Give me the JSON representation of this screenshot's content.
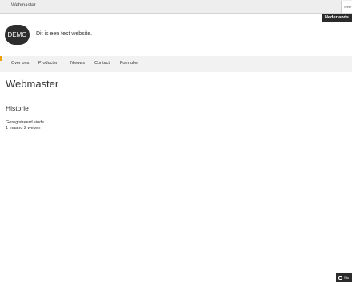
{
  "topbar": {
    "site_title": "Webmaster",
    "tab_label": "Webr"
  },
  "language": {
    "selected": "Nederlands"
  },
  "brand": {
    "logo_text": "DEMO",
    "tagline": "Dit is een test website."
  },
  "nav": {
    "items": [
      {
        "label": "Over ons"
      },
      {
        "label": "Producten"
      },
      {
        "label": "Nieuws"
      },
      {
        "label": "Contact"
      },
      {
        "label": "Formulier"
      }
    ]
  },
  "main": {
    "title": "Webmaster",
    "section_title": "Historie",
    "registered_label": "Geregistreerd sinds",
    "registered_value": "1 maand 2 weken"
  },
  "chat": {
    "label": "Sto"
  },
  "colors": {
    "accent": "#f0a000",
    "dark": "#2b2b2b",
    "nav_bg": "#f2f2f2"
  }
}
